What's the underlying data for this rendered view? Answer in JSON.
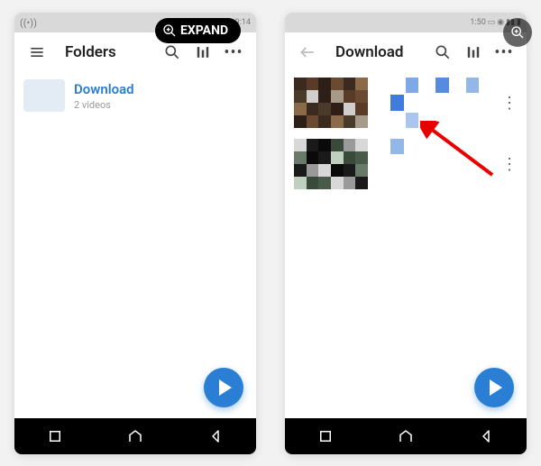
{
  "overlay": {
    "expand_label": "EXPAND"
  },
  "left": {
    "status": {
      "left_icon": "broadcast-icon",
      "time": "9:14"
    },
    "toolbar": {
      "title": "Folders"
    },
    "folder": {
      "name": "Download",
      "meta": "2 videos"
    }
  },
  "right": {
    "status": {
      "time": "1:50"
    },
    "toolbar": {
      "title": "Download"
    }
  },
  "colors": {
    "accent": "#2a7fd4"
  }
}
